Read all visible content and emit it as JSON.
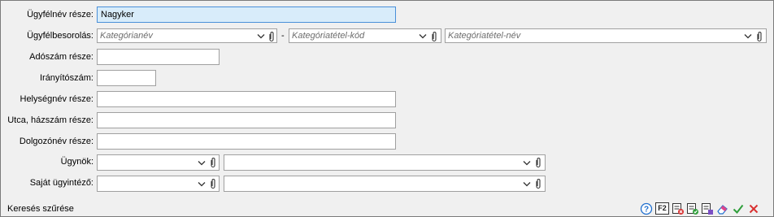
{
  "form": {
    "customer_name_part": {
      "label": "Ügyfélnév része:",
      "value": "Nagyker"
    },
    "classification": {
      "label": "Ügyfélbesorolás:",
      "category_name_placeholder": "Kategórianév",
      "separator": "-",
      "item_code_placeholder": "Kategóriatétel-kód",
      "item_name_placeholder": "Kategóriatétel-név"
    },
    "tax_number_part": {
      "label": "Adószám része:",
      "value": ""
    },
    "postal_code": {
      "label": "Irányítószám:",
      "value": ""
    },
    "city_part": {
      "label": "Helységnév része:",
      "value": ""
    },
    "street_part": {
      "label": "Utca, házszám része:",
      "value": ""
    },
    "employee_part": {
      "label": "Dolgozónév része:",
      "value": ""
    },
    "agents": {
      "label": "Ügynök:",
      "code_value": "",
      "name_value": ""
    },
    "own_handler": {
      "label": "Saját ügyintéző:",
      "code_value": "",
      "name_value": ""
    }
  },
  "footer": {
    "title": "Keresés szűrése",
    "icons": [
      "help-icon",
      "f2-icon",
      "clear-filter-icon",
      "save-filter-icon",
      "load-filter-icon",
      "eraser-icon",
      "ok-check-icon",
      "cancel-x-icon"
    ],
    "f2_label": "F2",
    "colors": {
      "ok": "#2e9e3a",
      "cancel": "#d83030",
      "help": "#1f6fcf"
    }
  }
}
